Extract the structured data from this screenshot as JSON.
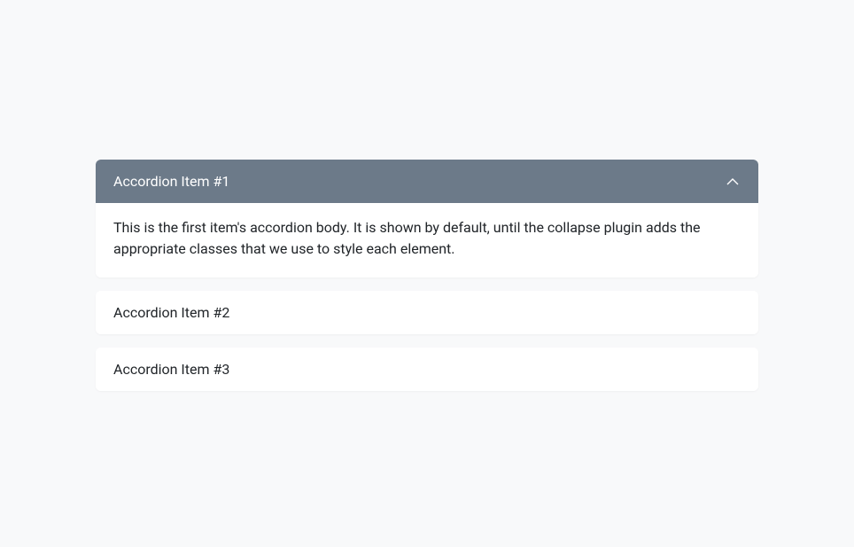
{
  "accordion": {
    "items": [
      {
        "title": "Accordion Item #1",
        "body": "This is the first item's accordion body. It is shown by default, until the collapse plugin adds the appropriate classes that we use to style each element.",
        "expanded": true
      },
      {
        "title": "Accordion Item #2",
        "expanded": false
      },
      {
        "title": "Accordion Item #3",
        "expanded": false
      }
    ]
  }
}
